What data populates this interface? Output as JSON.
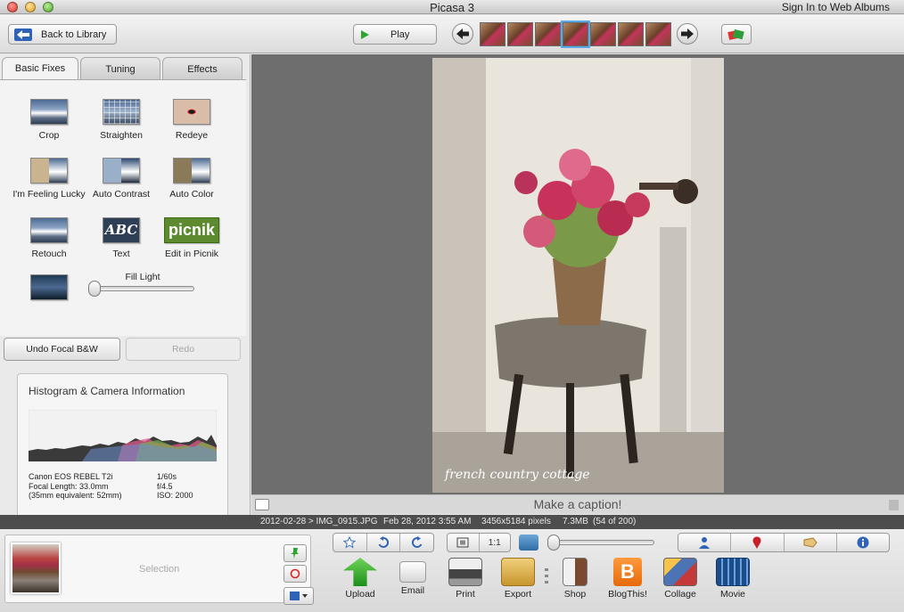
{
  "window": {
    "title": "Picasa 3",
    "sign_in": "Sign In to Web Albums"
  },
  "toolbar": {
    "back_label": "Back to Library",
    "play_label": "Play",
    "thumbnail_count": 7,
    "selected_thumbnail_index": 3
  },
  "tabs": [
    {
      "label": "Basic Fixes",
      "active": true
    },
    {
      "label": "Tuning",
      "active": false
    },
    {
      "label": "Effects",
      "active": false
    }
  ],
  "tools": {
    "crop": "Crop",
    "straighten": "Straighten",
    "redeye": "Redeye",
    "lucky": "I'm Feeling Lucky",
    "auto_contrast": "Auto Contrast",
    "auto_color": "Auto Color",
    "retouch": "Retouch",
    "text": "Text",
    "text_icon": "ABC",
    "picnik": "Edit in Picnik",
    "picnik_icon": "picnik",
    "fill_light": "Fill Light",
    "fill_light_value": 0
  },
  "history": {
    "undo": "Undo Focal B&W",
    "redo": "Redo"
  },
  "histogram": {
    "title": "Histogram & Camera Information",
    "camera": "Canon EOS REBEL T2i",
    "focal_length": "Focal Length: 33.0mm",
    "equivalent": "(35mm equivalent:  52mm)",
    "shutter": "1/60s",
    "aperture": "f/4.5",
    "iso": "ISO: 2000"
  },
  "photo": {
    "watermark": "french country cottage"
  },
  "caption": {
    "placeholder": "Make a caption!"
  },
  "info": {
    "path": "2012-02-28 > IMG_0915.JPG",
    "date": "Feb 28, 2012 3:55 AM",
    "dimensions": "3456x5184 pixels",
    "size": "7.3MB",
    "position": "(54 of 200)"
  },
  "tray": {
    "selection_label": "Selection",
    "zoom_1to1": "1:1",
    "zoom_value": 0,
    "actions": [
      "Upload",
      "Email",
      "Print",
      "Export",
      "Shop",
      "BlogThis!",
      "Collage",
      "Movie"
    ]
  },
  "colors": {
    "accent_green": "#2ea52e",
    "selection_blue": "#5aa9e8",
    "blogger_orange": "#e56a0b"
  }
}
